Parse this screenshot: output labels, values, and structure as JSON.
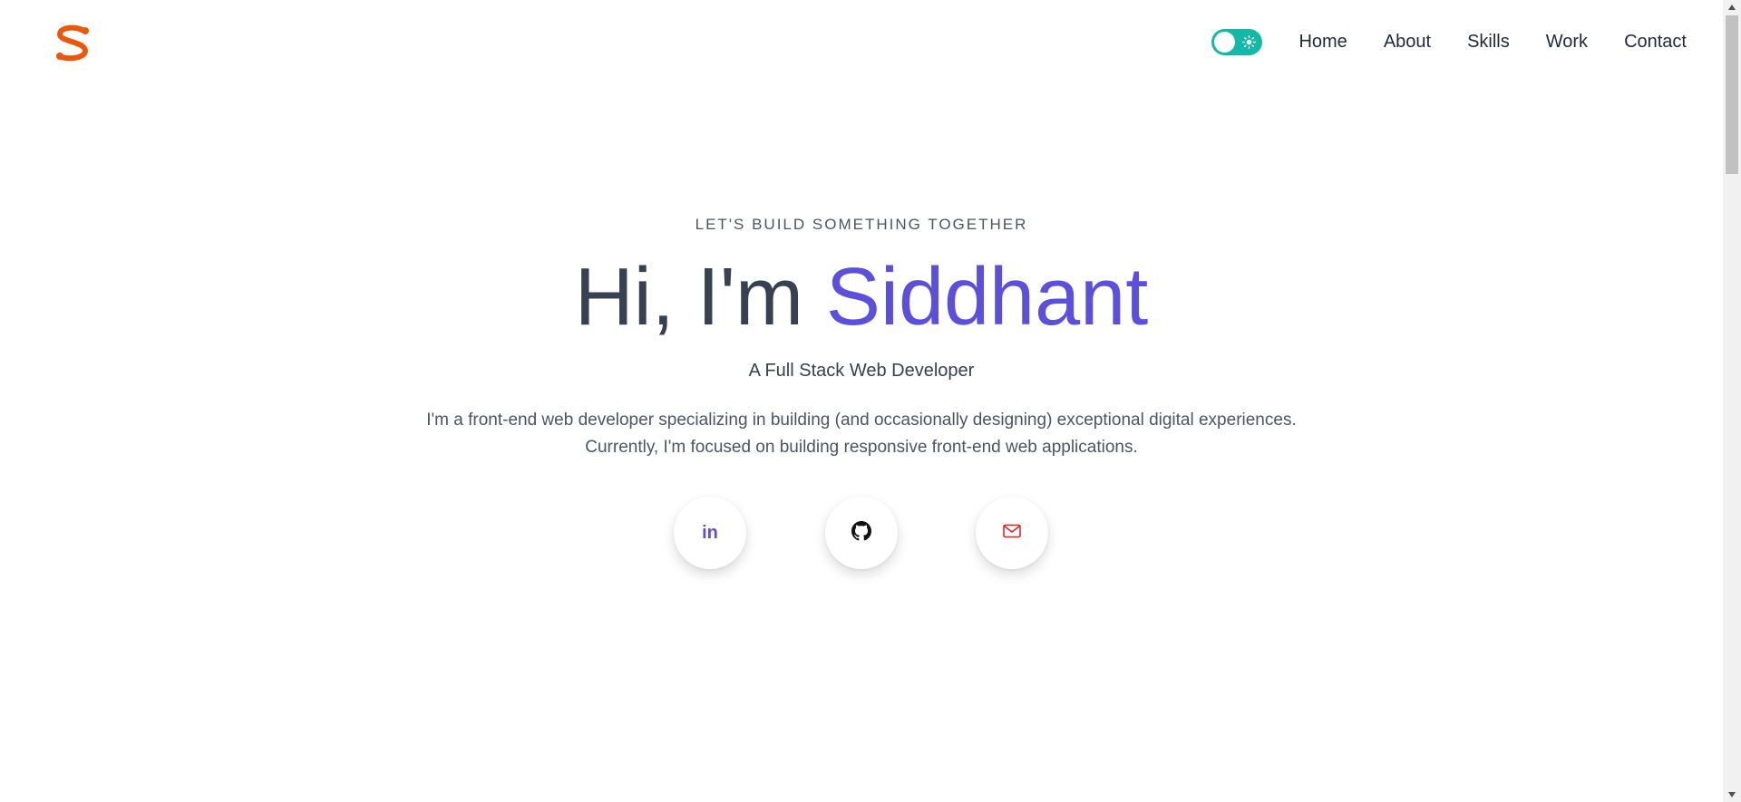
{
  "header": {
    "logo_icon": "s-logo-icon",
    "theme_toggle": {
      "state": "light",
      "icon": "sun-icon"
    },
    "nav": [
      {
        "label": "Home"
      },
      {
        "label": "About"
      },
      {
        "label": "Skills"
      },
      {
        "label": "Work"
      },
      {
        "label": "Contact"
      }
    ]
  },
  "hero": {
    "eyebrow": "LET'S BUILD SOMETHING TOGETHER",
    "greeting": "Hi, I'm ",
    "name": "Siddhant",
    "subtitle": "A Full Stack Web Developer",
    "description_line1": "I'm a front-end web developer specializing in building (and occasionally designing) exceptional digital experiences.",
    "description_line2": "Currently, I'm focused on building responsive front-end web applications.",
    "social": [
      {
        "icon": "linkedin-icon",
        "text": "in"
      },
      {
        "icon": "github-icon"
      },
      {
        "icon": "mail-icon"
      }
    ]
  },
  "colors": {
    "accent": "#5b4fdc",
    "logo": "#ea580c",
    "toggle": "#14b8a6",
    "mail": "#dc2626"
  }
}
